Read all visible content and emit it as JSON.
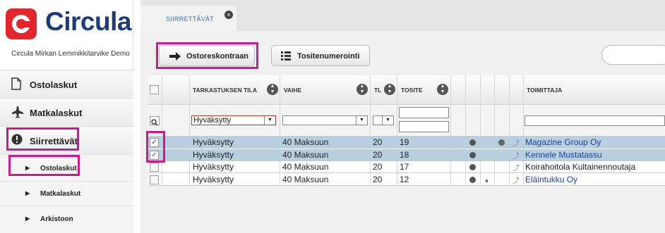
{
  "app": {
    "logo_text": "Circula",
    "company": "Circula Mirkan Lemmikkitarvike Demo"
  },
  "sidebar": {
    "items": [
      {
        "label": "Ostolaskut",
        "icon": "document-icon"
      },
      {
        "label": "Matkalaskut",
        "icon": "airplane-icon"
      },
      {
        "label": "Siirrettävät",
        "icon": "alert-icon"
      }
    ],
    "subitems": [
      {
        "label": "Ostolaskut"
      },
      {
        "label": "Matkalaskut"
      },
      {
        "label": "Arkistoon"
      }
    ]
  },
  "tabs": [
    {
      "label": "SIIRRETTÄVÄT",
      "close": "×"
    }
  ],
  "toolbar": {
    "transfer_label": "Ostoreskontraan",
    "renumber_label": "Tositenumerointi"
  },
  "grid": {
    "columns": [
      "TARKASTUKSEN TILA",
      "VAIHE",
      "TL",
      "TOSITE",
      "TOIMITTAJA"
    ],
    "filter": {
      "status": "Hyväksytty"
    },
    "rows": [
      {
        "selected": true,
        "status": "Hyväksytty",
        "stage": "40 Maksuun",
        "tl": "20",
        "doc": "19",
        "supplier": "Magazine Group Oy",
        "link": true
      },
      {
        "selected": true,
        "status": "Hyväksytty",
        "stage": "40 Maksuun",
        "tl": "20",
        "doc": "18",
        "supplier": "Kennele Mustatassu",
        "link": true
      },
      {
        "selected": false,
        "status": "Hyväksytty",
        "stage": "40 Maksuun",
        "tl": "20",
        "doc": "17",
        "supplier": "Koirahoitola Kultainennoutaja",
        "link": false
      },
      {
        "selected": false,
        "status": "Hyväksytty",
        "stage": "40 Maksuun",
        "tl": "20",
        "doc": "12",
        "supplier": "Eläintukku Oy",
        "link": true
      }
    ]
  },
  "colors": {
    "brand_red": "#e3262e",
    "brand_blue": "#1f3a78",
    "highlight": "#cc1a8c",
    "selected_row": "#b8cfe0",
    "link": "#1d3f9e"
  }
}
